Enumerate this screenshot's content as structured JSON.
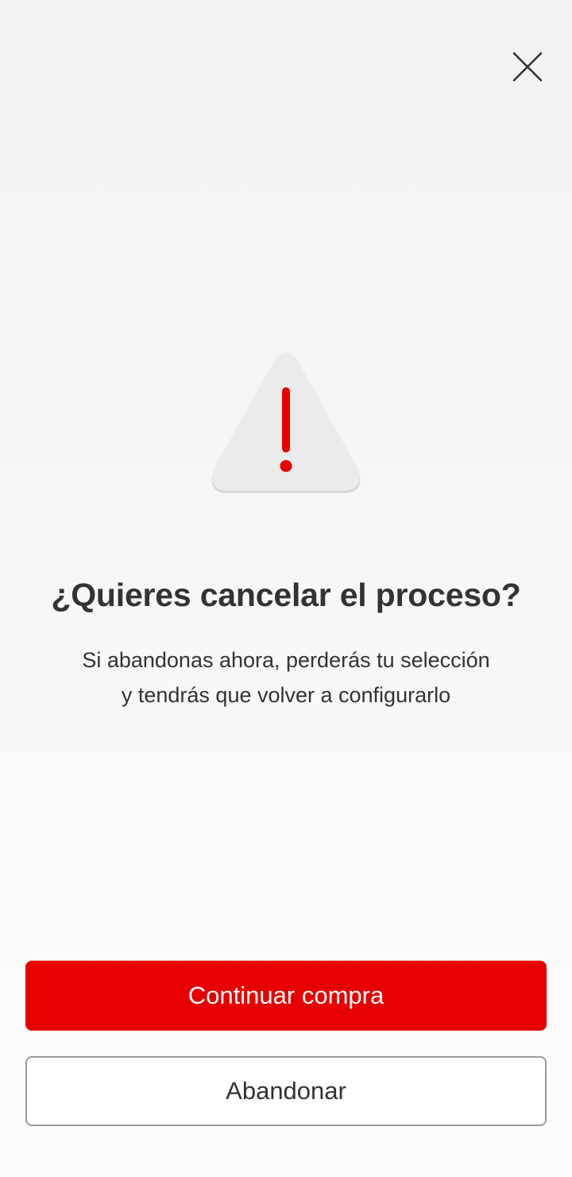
{
  "dialog": {
    "close_icon": "close-icon",
    "warning_icon": "warning-triangle-icon",
    "title": "¿Quieres cancelar el proceso?",
    "message_line1": "Si abandonas ahora, perderás tu selección",
    "message_line2": "y tendrás que volver a configurarlo"
  },
  "actions": {
    "continue_label": "Continuar compra",
    "abandon_label": "Abandonar"
  },
  "colors": {
    "accent": "#e60000",
    "text": "#333333",
    "icon_fill": "#ebebeb",
    "secondary_border": "#9a9a9a"
  }
}
